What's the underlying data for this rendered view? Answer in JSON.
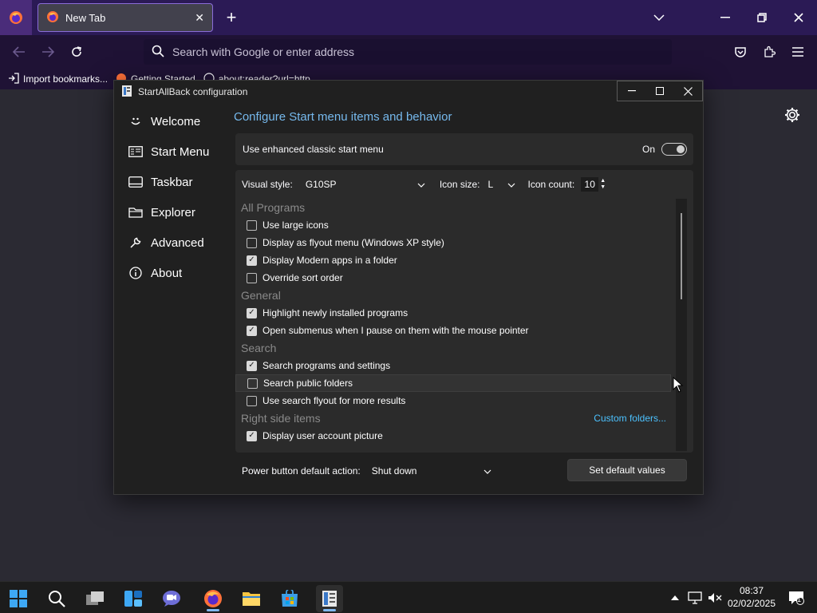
{
  "browser": {
    "tab_title": "New Tab",
    "url_placeholder": "Search with Google or enter address",
    "bookmarks": [
      "Import bookmarks...",
      "Getting Started",
      "about:reader?url=http..."
    ]
  },
  "dialog": {
    "title": "StartAllBack configuration",
    "sidebar": [
      {
        "label": "Welcome",
        "icon": "smiley-icon"
      },
      {
        "label": "Start Menu",
        "icon": "start-menu-icon"
      },
      {
        "label": "Taskbar",
        "icon": "taskbar-icon"
      },
      {
        "label": "Explorer",
        "icon": "folder-icon"
      },
      {
        "label": "Advanced",
        "icon": "wrench-icon"
      },
      {
        "label": "About",
        "icon": "info-icon"
      }
    ],
    "heading": "Configure Start menu items and behavior",
    "enhanced": {
      "label": "Use enhanced classic start menu",
      "state": "On"
    },
    "visual_style": {
      "label": "Visual style:",
      "value": "G10SP"
    },
    "icon_size": {
      "label": "Icon size:",
      "value": "L"
    },
    "icon_count": {
      "label": "Icon count:",
      "value": "10"
    },
    "groups": [
      {
        "header": "All Programs",
        "link": "",
        "items": [
          {
            "label": "Use large icons",
            "checked": false
          },
          {
            "label": "Display as flyout menu (Windows XP style)",
            "checked": false
          },
          {
            "label": "Display Modern apps in a folder",
            "checked": true
          },
          {
            "label": "Override sort order",
            "checked": false
          }
        ]
      },
      {
        "header": "General",
        "link": "",
        "items": [
          {
            "label": "Highlight newly installed programs",
            "checked": true
          },
          {
            "label": "Open submenus when I pause on them with the mouse pointer",
            "checked": true
          }
        ]
      },
      {
        "header": "Search",
        "link": "",
        "items": [
          {
            "label": "Search programs and settings",
            "checked": true
          },
          {
            "label": "Search public folders",
            "checked": false,
            "hover": true
          },
          {
            "label": "Use search flyout for more results",
            "checked": false
          }
        ]
      },
      {
        "header": "Right side items",
        "link": "Custom folders...",
        "items": [
          {
            "label": "Display user account picture",
            "checked": true
          }
        ]
      }
    ],
    "power": {
      "label": "Power button default action:",
      "value": "Shut down"
    },
    "default_button": "Set default values"
  },
  "taskbar": {
    "time": "08:37",
    "date": "02/02/2025",
    "notification_count": "1"
  },
  "colors": {
    "accent_link": "#4cc2ff",
    "heading": "#76b9ed",
    "browser_frame": "#2b1a55"
  }
}
